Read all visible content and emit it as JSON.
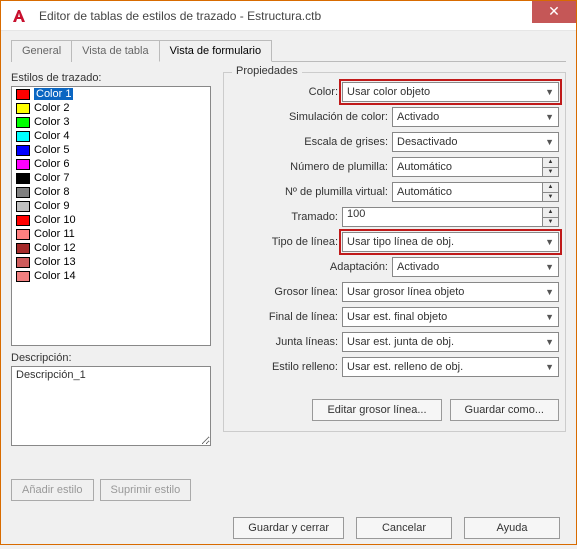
{
  "title": "Editor de tablas de estilos de trazado - Estructura.ctb",
  "tabs": [
    "General",
    "Vista de tabla",
    "Vista de formulario"
  ],
  "active_tab": 2,
  "left": {
    "styles_label": "Estilos de trazado:",
    "items": [
      {
        "c": "#ff0000",
        "n": "Color 1",
        "sel": true
      },
      {
        "c": "#ffff00",
        "n": "Color 2"
      },
      {
        "c": "#00ff00",
        "n": "Color 3"
      },
      {
        "c": "#00ffff",
        "n": "Color 4"
      },
      {
        "c": "#0000ff",
        "n": "Color 5"
      },
      {
        "c": "#ff00ff",
        "n": "Color 6"
      },
      {
        "c": "#000000",
        "n": "Color 7"
      },
      {
        "c": "#808080",
        "n": "Color 8"
      },
      {
        "c": "#c0c0c0",
        "n": "Color 9"
      },
      {
        "c": "#ff0000",
        "n": "Color 10"
      },
      {
        "c": "#ff8080",
        "n": "Color 11"
      },
      {
        "c": "#a52a2a",
        "n": "Color 12"
      },
      {
        "c": "#cd5c5c",
        "n": "Color 13"
      },
      {
        "c": "#f08080",
        "n": "Color 14"
      }
    ],
    "desc_label": "Descripción:",
    "desc_value": "Descripción_1",
    "add_btn": "Añadir estilo",
    "del_btn": "Suprimir estilo"
  },
  "props": {
    "legend": "Propiedades",
    "color_label": "Color:",
    "color_value": "Usar color objeto",
    "sim_label": "Simulación de color:",
    "sim_value": "Activado",
    "gray_label": "Escala de grises:",
    "gray_value": "Desactivado",
    "pen_label": "Número de plumilla:",
    "pen_value": "Automático",
    "vpen_label": "Nº de plumilla virtual:",
    "vpen_value": "Automático",
    "screen_label": "Tramado:",
    "screen_value": "100",
    "lt_label": "Tipo de línea:",
    "lt_value": "Usar tipo línea de obj.",
    "adapt_label": "Adaptación:",
    "adapt_value": "Activado",
    "lw_label": "Grosor línea:",
    "lw_value": "Usar grosor línea objeto",
    "end_label": "Final de línea:",
    "end_value": "Usar est. final objeto",
    "join_label": "Junta líneas:",
    "join_value": "Usar est. junta de obj.",
    "fill_label": "Estilo relleno:",
    "fill_value": "Usar est. relleno de obj.",
    "edit_lw": "Editar grosor línea...",
    "save_as": "Guardar como..."
  },
  "bottom": {
    "save": "Guardar y cerrar",
    "cancel": "Cancelar",
    "help": "Ayuda"
  }
}
